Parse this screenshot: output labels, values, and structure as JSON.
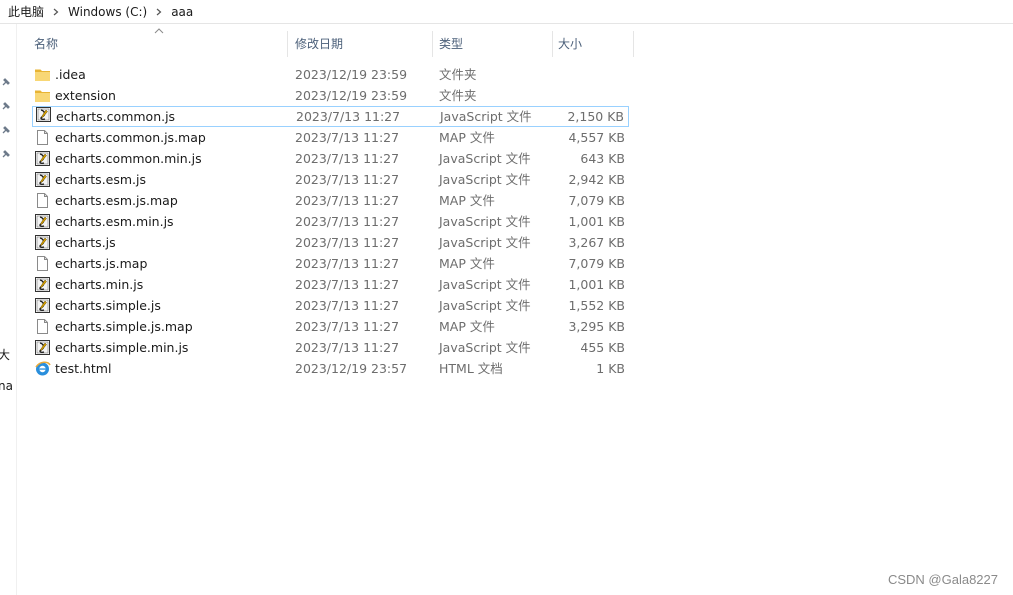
{
  "breadcrumb": [
    "此电脑",
    "Windows (C:)",
    "aaa"
  ],
  "nav_fragments": [
    "大",
    "na"
  ],
  "columns": {
    "name": "名称",
    "date": "修改日期",
    "type": "类型",
    "size": "大小"
  },
  "files": [
    {
      "name": ".idea",
      "date": "2023/12/19 23:59",
      "type": "文件夹",
      "size": "",
      "icon": "folder-icon"
    },
    {
      "name": "extension",
      "date": "2023/12/19 23:59",
      "type": "文件夹",
      "size": "",
      "icon": "folder-icon"
    },
    {
      "name": "echarts.common.js",
      "date": "2023/7/13 11:27",
      "type": "JavaScript 文件",
      "size": "2,150 KB",
      "icon": "js-file-icon"
    },
    {
      "name": "echarts.common.js.map",
      "date": "2023/7/13 11:27",
      "type": "MAP 文件",
      "size": "4,557 KB",
      "icon": "generic-file-icon"
    },
    {
      "name": "echarts.common.min.js",
      "date": "2023/7/13 11:27",
      "type": "JavaScript 文件",
      "size": "643 KB",
      "icon": "js-file-icon"
    },
    {
      "name": "echarts.esm.js",
      "date": "2023/7/13 11:27",
      "type": "JavaScript 文件",
      "size": "2,942 KB",
      "icon": "js-file-icon"
    },
    {
      "name": "echarts.esm.js.map",
      "date": "2023/7/13 11:27",
      "type": "MAP 文件",
      "size": "7,079 KB",
      "icon": "generic-file-icon"
    },
    {
      "name": "echarts.esm.min.js",
      "date": "2023/7/13 11:27",
      "type": "JavaScript 文件",
      "size": "1,001 KB",
      "icon": "js-file-icon"
    },
    {
      "name": "echarts.js",
      "date": "2023/7/13 11:27",
      "type": "JavaScript 文件",
      "size": "3,267 KB",
      "icon": "js-file-icon"
    },
    {
      "name": "echarts.js.map",
      "date": "2023/7/13 11:27",
      "type": "MAP 文件",
      "size": "7,079 KB",
      "icon": "generic-file-icon"
    },
    {
      "name": "echarts.min.js",
      "date": "2023/7/13 11:27",
      "type": "JavaScript 文件",
      "size": "1,001 KB",
      "icon": "js-file-icon"
    },
    {
      "name": "echarts.simple.js",
      "date": "2023/7/13 11:27",
      "type": "JavaScript 文件",
      "size": "1,552 KB",
      "icon": "js-file-icon"
    },
    {
      "name": "echarts.simple.js.map",
      "date": "2023/7/13 11:27",
      "type": "MAP 文件",
      "size": "3,295 KB",
      "icon": "generic-file-icon"
    },
    {
      "name": "echarts.simple.min.js",
      "date": "2023/7/13 11:27",
      "type": "JavaScript 文件",
      "size": "455 KB",
      "icon": "js-file-icon"
    },
    {
      "name": "test.html",
      "date": "2023/12/19 23:57",
      "type": "HTML 文档",
      "size": "1 KB",
      "icon": "html-file-icon"
    }
  ],
  "selected_file": "echarts.common.js",
  "watermark": "CSDN @Gala8227",
  "colors": {
    "selection_border": "#99d1ff",
    "header_text": "#4c607a",
    "folder": "#f5c342"
  }
}
